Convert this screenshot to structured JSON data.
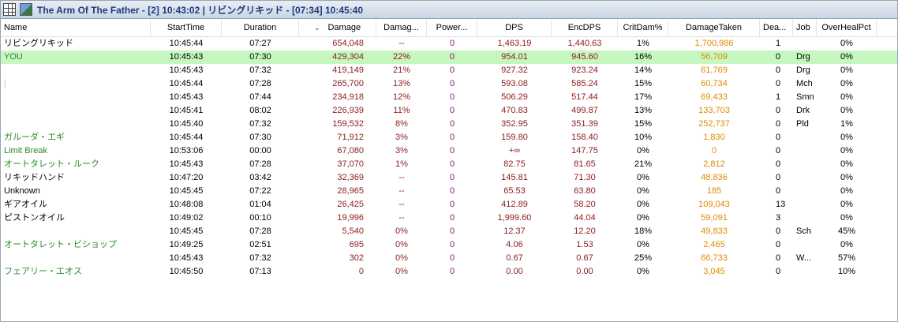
{
  "window": {
    "title": "The Arm Of The Father - [2] 10:43:02 | リビングリキッド - [07:34] 10:45:40"
  },
  "colors": {
    "you_row": "#c6f7c1",
    "pet_name": "#2a8a2a",
    "damage": "#8b1c1c",
    "power": "#7a1f6e",
    "damage_taken": "#e08a00"
  },
  "columns": [
    "Name",
    "StartTime",
    "Duration",
    "Damage",
    "Damag...",
    "Power...",
    "DPS",
    "EncDPS",
    "CritDam%",
    "DamageTaken",
    "Dea...",
    "Job",
    "OverHealPct"
  ],
  "sort_icon": "chevron-down-icon",
  "rows": [
    {
      "name": "リビングリキッド",
      "start": "10:45:44",
      "dur": "07:27",
      "damage": "654,048",
      "dmgpct": "--",
      "power": "0",
      "dps": "1,463.19",
      "encdps": "1,440.63",
      "crit": "1%",
      "taken": "1,700,986",
      "deaths": "1",
      "job": "",
      "overheal": "0%",
      "style": "normal"
    },
    {
      "name": "YOU",
      "start": "10:45:43",
      "dur": "07:30",
      "damage": "429,304",
      "dmgpct": "22%",
      "power": "0",
      "dps": "954.01",
      "encdps": "945.60",
      "crit": "16%",
      "taken": "56,709",
      "deaths": "0",
      "job": "Drg",
      "overheal": "0%",
      "style": "you"
    },
    {
      "name": "",
      "start": "10:45:43",
      "dur": "07:32",
      "damage": "419,149",
      "dmgpct": "21%",
      "power": "0",
      "dps": "927.32",
      "encdps": "923.24",
      "crit": "14%",
      "taken": "61,769",
      "deaths": "0",
      "job": "Drg",
      "overheal": "0%",
      "style": "normal"
    },
    {
      "name": "|",
      "start": "10:45:44",
      "dur": "07:28",
      "damage": "265,700",
      "dmgpct": "13%",
      "power": "0",
      "dps": "593.08",
      "encdps": "585.24",
      "crit": "15%",
      "taken": "60,734",
      "deaths": "0",
      "job": "Mch",
      "overheal": "0%",
      "style": "faint"
    },
    {
      "name": "",
      "start": "10:45:43",
      "dur": "07:44",
      "damage": "234,918",
      "dmgpct": "12%",
      "power": "0",
      "dps": "506.29",
      "encdps": "517.44",
      "crit": "17%",
      "taken": "69,433",
      "deaths": "1",
      "job": "Smn",
      "overheal": "0%",
      "style": "normal"
    },
    {
      "name": "",
      "start": "10:45:41",
      "dur": "08:02",
      "damage": "226,939",
      "dmgpct": "11%",
      "power": "0",
      "dps": "470.83",
      "encdps": "499.87",
      "crit": "13%",
      "taken": "133,703",
      "deaths": "0",
      "job": "Drk",
      "overheal": "0%",
      "style": "normal"
    },
    {
      "name": "",
      "start": "10:45:40",
      "dur": "07:32",
      "damage": "159,532",
      "dmgpct": "8%",
      "power": "0",
      "dps": "352.95",
      "encdps": "351.39",
      "crit": "15%",
      "taken": "252,737",
      "deaths": "0",
      "job": "Pld",
      "overheal": "1%",
      "style": "normal"
    },
    {
      "name": "ガルーダ・エギ",
      "start": "10:45:44",
      "dur": "07:30",
      "damage": "71,912",
      "dmgpct": "3%",
      "power": "0",
      "dps": "159.80",
      "encdps": "158.40",
      "crit": "10%",
      "taken": "1,830",
      "deaths": "0",
      "job": "",
      "overheal": "0%",
      "style": "pet"
    },
    {
      "name": "Limit Break",
      "start": "10:53:06",
      "dur": "00:00",
      "damage": "67,080",
      "dmgpct": "3%",
      "power": "0",
      "dps": "+∞",
      "encdps": "147.75",
      "crit": "0%",
      "taken": "0",
      "deaths": "0",
      "job": "",
      "overheal": "0%",
      "style": "pet"
    },
    {
      "name": "オートタレット・ルーク",
      "start": "10:45:43",
      "dur": "07:28",
      "damage": "37,070",
      "dmgpct": "1%",
      "power": "0",
      "dps": "82.75",
      "encdps": "81.65",
      "crit": "21%",
      "taken": "2,812",
      "deaths": "0",
      "job": "",
      "overheal": "0%",
      "style": "pet"
    },
    {
      "name": "リキッドハンド",
      "start": "10:47:20",
      "dur": "03:42",
      "damage": "32,369",
      "dmgpct": "--",
      "power": "0",
      "dps": "145.81",
      "encdps": "71.30",
      "crit": "0%",
      "taken": "48,836",
      "deaths": "0",
      "job": "",
      "overheal": "0%",
      "style": "normal"
    },
    {
      "name": "Unknown",
      "start": "10:45:45",
      "dur": "07:22",
      "damage": "28,965",
      "dmgpct": "--",
      "power": "0",
      "dps": "65.53",
      "encdps": "63.80",
      "crit": "0%",
      "taken": "185",
      "deaths": "0",
      "job": "",
      "overheal": "0%",
      "style": "normal"
    },
    {
      "name": "ギアオイル",
      "start": "10:48:08",
      "dur": "01:04",
      "damage": "26,425",
      "dmgpct": "--",
      "power": "0",
      "dps": "412.89",
      "encdps": "58.20",
      "crit": "0%",
      "taken": "109,043",
      "deaths": "13",
      "job": "",
      "overheal": "0%",
      "style": "normal"
    },
    {
      "name": "ピストンオイル",
      "start": "10:49:02",
      "dur": "00:10",
      "damage": "19,996",
      "dmgpct": "--",
      "power": "0",
      "dps": "1,999.60",
      "encdps": "44.04",
      "crit": "0%",
      "taken": "59,091",
      "deaths": "3",
      "job": "",
      "overheal": "0%",
      "style": "normal"
    },
    {
      "name": "",
      "start": "10:45:45",
      "dur": "07:28",
      "damage": "5,540",
      "dmgpct": "0%",
      "power": "0",
      "dps": "12.37",
      "encdps": "12.20",
      "crit": "18%",
      "taken": "49,833",
      "deaths": "0",
      "job": "Sch",
      "overheal": "45%",
      "style": "normal"
    },
    {
      "name": "オートタレット・ビショップ",
      "start": "10:49:25",
      "dur": "02:51",
      "damage": "695",
      "dmgpct": "0%",
      "power": "0",
      "dps": "4.06",
      "encdps": "1.53",
      "crit": "0%",
      "taken": "2,465",
      "deaths": "0",
      "job": "",
      "overheal": "0%",
      "style": "pet"
    },
    {
      "name": "",
      "start": "10:45:43",
      "dur": "07:32",
      "damage": "302",
      "dmgpct": "0%",
      "power": "0",
      "dps": "0.67",
      "encdps": "0.67",
      "crit": "25%",
      "taken": "66,733",
      "deaths": "0",
      "job": "W...",
      "overheal": "57%",
      "style": "normal"
    },
    {
      "name": "フェアリー・エオス",
      "start": "10:45:50",
      "dur": "07:13",
      "damage": "0",
      "dmgpct": "0%",
      "power": "0",
      "dps": "0.00",
      "encdps": "0.00",
      "crit": "0%",
      "taken": "3,045",
      "deaths": "0",
      "job": "",
      "overheal": "10%",
      "style": "pet"
    }
  ]
}
